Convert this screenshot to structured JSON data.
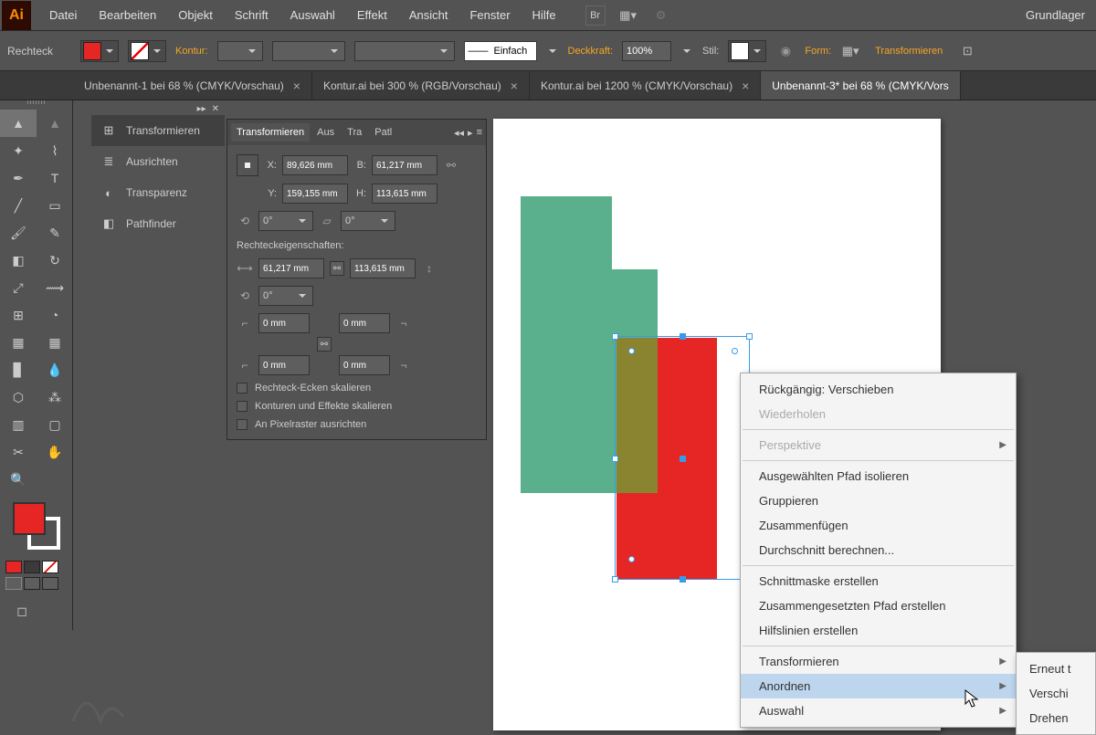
{
  "menu": {
    "items": [
      "Datei",
      "Bearbeiten",
      "Objekt",
      "Schrift",
      "Auswahl",
      "Effekt",
      "Ansicht",
      "Fenster",
      "Hilfe"
    ],
    "right": "Grundlager"
  },
  "controlbar": {
    "context": "Rechteck",
    "fill": "#e62525",
    "stroke_label": "Kontur:",
    "weight": "",
    "style_label": "Einfach",
    "opacity_label": "Deckkraft:",
    "opacity": "100%",
    "stil_label": "Stil:",
    "form_label": "Form:",
    "transform_btn": "Transformieren"
  },
  "tabs": [
    {
      "label": "Unbenannt-1 bei 68 % (CMYK/Vorschau)",
      "active": false
    },
    {
      "label": "Kontur.ai bei 300 % (RGB/Vorschau)",
      "active": false
    },
    {
      "label": "Kontur.ai bei 1200 % (CMYK/Vorschau)",
      "active": false
    },
    {
      "label": "Unbenannt-3* bei 68 % (CMYK/Vors",
      "active": true
    }
  ],
  "dock": {
    "items": [
      {
        "label": "Transformieren",
        "icon": "⊞",
        "sel": true
      },
      {
        "label": "Ausrichten",
        "icon": "≡"
      },
      {
        "label": "Transparenz",
        "icon": "◐"
      },
      {
        "label": "Pathfinder",
        "icon": "◧"
      }
    ]
  },
  "transform": {
    "tabs": [
      "Transformieren",
      "Aus",
      "Tra",
      "Patl"
    ],
    "x": "89,626 mm",
    "y": "159,155 mm",
    "B": "61,217 mm",
    "H": "113,615 mm",
    "angle": "0°",
    "shear": "0°",
    "section": "Rechteckeigenschaften:",
    "rw": "61,217 mm",
    "rh": "113,615 mm",
    "rot": "0°",
    "c1": "0 mm",
    "c2": "0 mm",
    "c3": "0 mm",
    "c4": "0 mm",
    "chk1": "Rechteck-Ecken skalieren",
    "chk2": "Konturen und Effekte skalieren",
    "chk3": "An Pixelraster ausrichten"
  },
  "context_menu": {
    "items": [
      {
        "label": "Rückgängig: Verschieben"
      },
      {
        "label": "Wiederholen",
        "dis": true
      },
      {
        "sep": true
      },
      {
        "label": "Perspektive",
        "dis": true,
        "sub": true
      },
      {
        "sep": true
      },
      {
        "label": "Ausgewählten Pfad isolieren"
      },
      {
        "label": "Gruppieren"
      },
      {
        "label": "Zusammenfügen"
      },
      {
        "label": "Durchschnitt berechnen..."
      },
      {
        "sep": true
      },
      {
        "label": "Schnittmaske erstellen"
      },
      {
        "label": "Zusammengesetzten Pfad erstellen"
      },
      {
        "label": "Hilfslinien erstellen"
      },
      {
        "sep": true
      },
      {
        "label": "Transformieren",
        "sub": true
      },
      {
        "label": "Anordnen",
        "sub": true,
        "hl": true
      },
      {
        "label": "Auswahl",
        "sub": true
      }
    ],
    "submenu": [
      "Erneut t",
      "Verschi",
      "Drehen"
    ]
  }
}
